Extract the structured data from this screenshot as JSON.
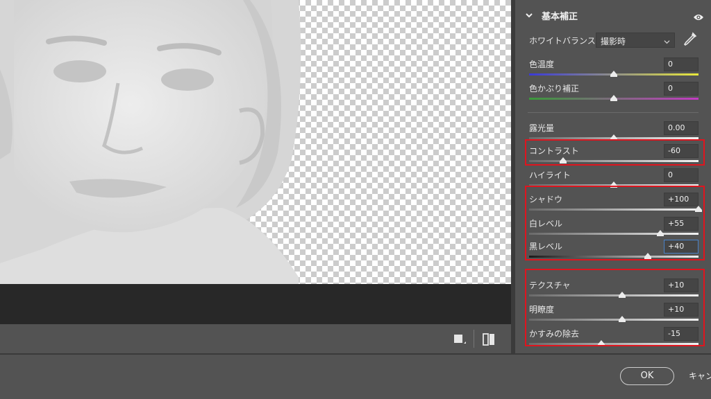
{
  "panel": {
    "section_title": "基本補正",
    "white_balance": {
      "label": "ホワイトバランス",
      "value": "撮影時"
    },
    "sliders": [
      {
        "label": "色温度",
        "value": "0",
        "level": 0.5,
        "track": "temp"
      },
      {
        "label": "色かぶり補正",
        "value": "0",
        "level": 0.5,
        "track": "tint"
      },
      {
        "label": "露光量",
        "value": "0.00",
        "level": 0.5,
        "track": "gray"
      },
      {
        "label": "コントラスト",
        "value": "-60",
        "level": 0.2,
        "track": "gray"
      },
      {
        "label": "ハイライト",
        "value": "0",
        "level": 0.5,
        "track": "gray"
      },
      {
        "label": "シャドウ",
        "value": "+100",
        "level": 1.0,
        "track": "gray"
      },
      {
        "label": "白レベル",
        "value": "+55",
        "level": 0.775,
        "track": "gray"
      },
      {
        "label": "黒レベル",
        "value": "+40",
        "level": 0.7,
        "track": "dark",
        "active": true
      },
      {
        "label": "テクスチャ",
        "value": "+10",
        "level": 0.55,
        "track": "gray"
      },
      {
        "label": "明瞭度",
        "value": "+10",
        "level": 0.55,
        "track": "gray"
      },
      {
        "label": "かすみの除去",
        "value": "-15",
        "level": 0.425,
        "track": "gray"
      }
    ]
  },
  "footer": {
    "ok_label": "OK",
    "cancel_label": "キャンセル"
  },
  "colors": {
    "highlight_box": "#e0141e",
    "panel_bg": "#535353",
    "canvas_dark": "#282828"
  },
  "icons": [
    "chevron-down-icon",
    "eye-icon",
    "eyedropper-icon",
    "single-view-icon",
    "before-after-icon"
  ]
}
